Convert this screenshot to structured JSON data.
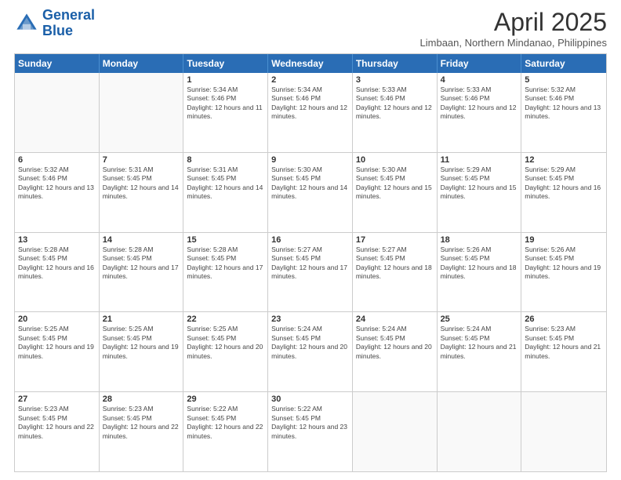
{
  "header": {
    "logo_line1": "General",
    "logo_line2": "Blue",
    "month": "April 2025",
    "location": "Limbaan, Northern Mindanao, Philippines"
  },
  "days_of_week": [
    "Sunday",
    "Monday",
    "Tuesday",
    "Wednesday",
    "Thursday",
    "Friday",
    "Saturday"
  ],
  "weeks": [
    [
      {
        "day": "",
        "sunrise": "",
        "sunset": "",
        "daylight": ""
      },
      {
        "day": "",
        "sunrise": "",
        "sunset": "",
        "daylight": ""
      },
      {
        "day": "1",
        "sunrise": "Sunrise: 5:34 AM",
        "sunset": "Sunset: 5:46 PM",
        "daylight": "Daylight: 12 hours and 11 minutes."
      },
      {
        "day": "2",
        "sunrise": "Sunrise: 5:34 AM",
        "sunset": "Sunset: 5:46 PM",
        "daylight": "Daylight: 12 hours and 12 minutes."
      },
      {
        "day": "3",
        "sunrise": "Sunrise: 5:33 AM",
        "sunset": "Sunset: 5:46 PM",
        "daylight": "Daylight: 12 hours and 12 minutes."
      },
      {
        "day": "4",
        "sunrise": "Sunrise: 5:33 AM",
        "sunset": "Sunset: 5:46 PM",
        "daylight": "Daylight: 12 hours and 12 minutes."
      },
      {
        "day": "5",
        "sunrise": "Sunrise: 5:32 AM",
        "sunset": "Sunset: 5:46 PM",
        "daylight": "Daylight: 12 hours and 13 minutes."
      }
    ],
    [
      {
        "day": "6",
        "sunrise": "Sunrise: 5:32 AM",
        "sunset": "Sunset: 5:46 PM",
        "daylight": "Daylight: 12 hours and 13 minutes."
      },
      {
        "day": "7",
        "sunrise": "Sunrise: 5:31 AM",
        "sunset": "Sunset: 5:45 PM",
        "daylight": "Daylight: 12 hours and 14 minutes."
      },
      {
        "day": "8",
        "sunrise": "Sunrise: 5:31 AM",
        "sunset": "Sunset: 5:45 PM",
        "daylight": "Daylight: 12 hours and 14 minutes."
      },
      {
        "day": "9",
        "sunrise": "Sunrise: 5:30 AM",
        "sunset": "Sunset: 5:45 PM",
        "daylight": "Daylight: 12 hours and 14 minutes."
      },
      {
        "day": "10",
        "sunrise": "Sunrise: 5:30 AM",
        "sunset": "Sunset: 5:45 PM",
        "daylight": "Daylight: 12 hours and 15 minutes."
      },
      {
        "day": "11",
        "sunrise": "Sunrise: 5:29 AM",
        "sunset": "Sunset: 5:45 PM",
        "daylight": "Daylight: 12 hours and 15 minutes."
      },
      {
        "day": "12",
        "sunrise": "Sunrise: 5:29 AM",
        "sunset": "Sunset: 5:45 PM",
        "daylight": "Daylight: 12 hours and 16 minutes."
      }
    ],
    [
      {
        "day": "13",
        "sunrise": "Sunrise: 5:28 AM",
        "sunset": "Sunset: 5:45 PM",
        "daylight": "Daylight: 12 hours and 16 minutes."
      },
      {
        "day": "14",
        "sunrise": "Sunrise: 5:28 AM",
        "sunset": "Sunset: 5:45 PM",
        "daylight": "Daylight: 12 hours and 17 minutes."
      },
      {
        "day": "15",
        "sunrise": "Sunrise: 5:28 AM",
        "sunset": "Sunset: 5:45 PM",
        "daylight": "Daylight: 12 hours and 17 minutes."
      },
      {
        "day": "16",
        "sunrise": "Sunrise: 5:27 AM",
        "sunset": "Sunset: 5:45 PM",
        "daylight": "Daylight: 12 hours and 17 minutes."
      },
      {
        "day": "17",
        "sunrise": "Sunrise: 5:27 AM",
        "sunset": "Sunset: 5:45 PM",
        "daylight": "Daylight: 12 hours and 18 minutes."
      },
      {
        "day": "18",
        "sunrise": "Sunrise: 5:26 AM",
        "sunset": "Sunset: 5:45 PM",
        "daylight": "Daylight: 12 hours and 18 minutes."
      },
      {
        "day": "19",
        "sunrise": "Sunrise: 5:26 AM",
        "sunset": "Sunset: 5:45 PM",
        "daylight": "Daylight: 12 hours and 19 minutes."
      }
    ],
    [
      {
        "day": "20",
        "sunrise": "Sunrise: 5:25 AM",
        "sunset": "Sunset: 5:45 PM",
        "daylight": "Daylight: 12 hours and 19 minutes."
      },
      {
        "day": "21",
        "sunrise": "Sunrise: 5:25 AM",
        "sunset": "Sunset: 5:45 PM",
        "daylight": "Daylight: 12 hours and 19 minutes."
      },
      {
        "day": "22",
        "sunrise": "Sunrise: 5:25 AM",
        "sunset": "Sunset: 5:45 PM",
        "daylight": "Daylight: 12 hours and 20 minutes."
      },
      {
        "day": "23",
        "sunrise": "Sunrise: 5:24 AM",
        "sunset": "Sunset: 5:45 PM",
        "daylight": "Daylight: 12 hours and 20 minutes."
      },
      {
        "day": "24",
        "sunrise": "Sunrise: 5:24 AM",
        "sunset": "Sunset: 5:45 PM",
        "daylight": "Daylight: 12 hours and 20 minutes."
      },
      {
        "day": "25",
        "sunrise": "Sunrise: 5:24 AM",
        "sunset": "Sunset: 5:45 PM",
        "daylight": "Daylight: 12 hours and 21 minutes."
      },
      {
        "day": "26",
        "sunrise": "Sunrise: 5:23 AM",
        "sunset": "Sunset: 5:45 PM",
        "daylight": "Daylight: 12 hours and 21 minutes."
      }
    ],
    [
      {
        "day": "27",
        "sunrise": "Sunrise: 5:23 AM",
        "sunset": "Sunset: 5:45 PM",
        "daylight": "Daylight: 12 hours and 22 minutes."
      },
      {
        "day": "28",
        "sunrise": "Sunrise: 5:23 AM",
        "sunset": "Sunset: 5:45 PM",
        "daylight": "Daylight: 12 hours and 22 minutes."
      },
      {
        "day": "29",
        "sunrise": "Sunrise: 5:22 AM",
        "sunset": "Sunset: 5:45 PM",
        "daylight": "Daylight: 12 hours and 22 minutes."
      },
      {
        "day": "30",
        "sunrise": "Sunrise: 5:22 AM",
        "sunset": "Sunset: 5:45 PM",
        "daylight": "Daylight: 12 hours and 23 minutes."
      },
      {
        "day": "",
        "sunrise": "",
        "sunset": "",
        "daylight": ""
      },
      {
        "day": "",
        "sunrise": "",
        "sunset": "",
        "daylight": ""
      },
      {
        "day": "",
        "sunrise": "",
        "sunset": "",
        "daylight": ""
      }
    ]
  ]
}
